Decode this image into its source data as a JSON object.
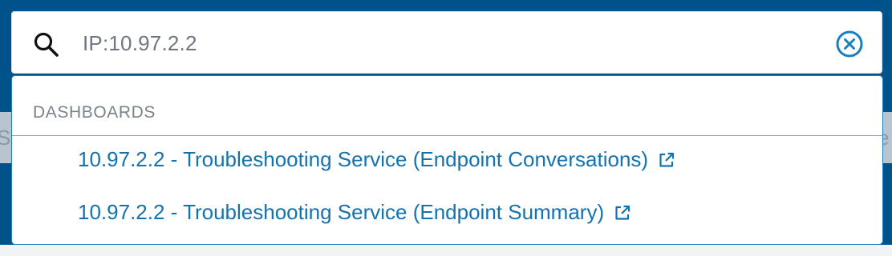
{
  "search": {
    "value": "IP:10.97.2.2",
    "search_icon": "search-icon",
    "clear_icon": "clear-circle-icon"
  },
  "background": {
    "left_fragment": "S",
    "right_fragment": "e"
  },
  "dropdown": {
    "section_title": "DASHBOARDS",
    "items": [
      {
        "label": "10.97.2.2 - Troubleshooting Service (Endpoint Conversations)",
        "icon": "external-link-icon"
      },
      {
        "label": "10.97.2.2 - Troubleshooting Service (Endpoint Summary)",
        "icon": "external-link-icon"
      }
    ]
  },
  "colors": {
    "header_bg": "#00538a",
    "link": "#1273b0",
    "focus_border": "#1a7fbf",
    "muted_text": "#7b8189"
  }
}
